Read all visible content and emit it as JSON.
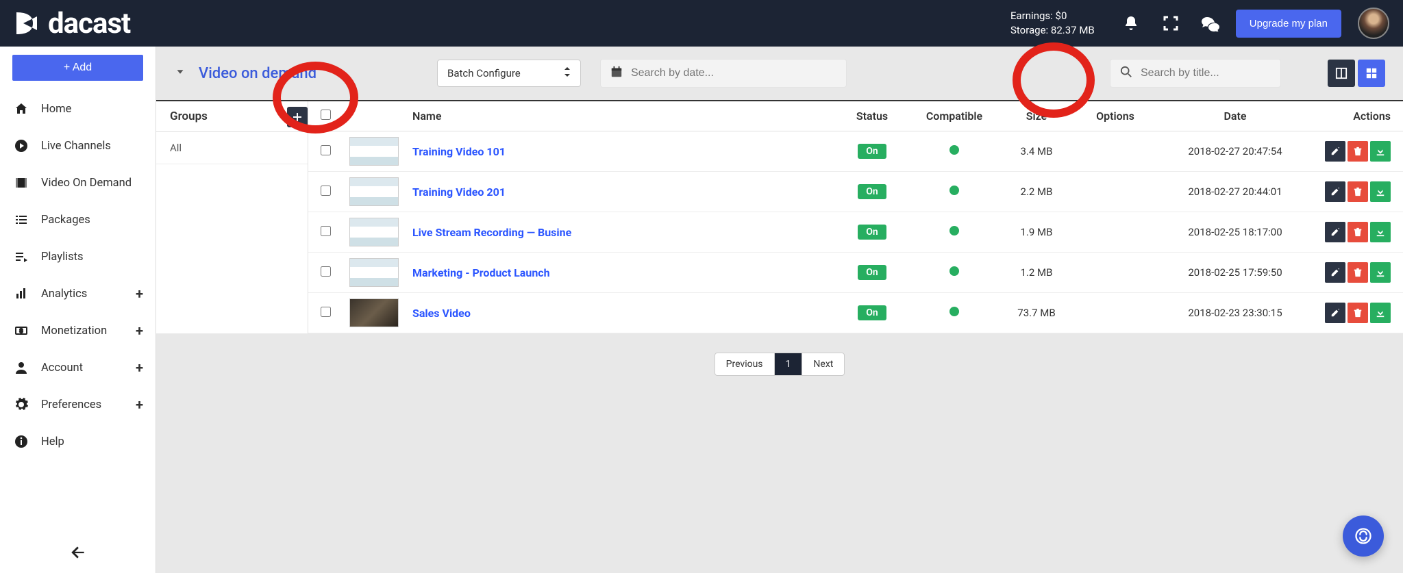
{
  "header": {
    "brand": "dacast",
    "earnings_label": "Earnings:",
    "earnings_value": "$0",
    "storage_label": "Storage:",
    "storage_value": "82.37 MB",
    "upgrade": "Upgrade my plan"
  },
  "sidebar": {
    "add_label": "+ Add",
    "items": [
      {
        "label": "Home"
      },
      {
        "label": "Live Channels"
      },
      {
        "label": "Video On Demand"
      },
      {
        "label": "Packages"
      },
      {
        "label": "Playlists"
      },
      {
        "label": "Analytics",
        "expandable": true
      },
      {
        "label": "Monetization",
        "expandable": true
      },
      {
        "label": "Account",
        "expandable": true
      },
      {
        "label": "Preferences",
        "expandable": true
      },
      {
        "label": "Help"
      }
    ]
  },
  "toolbar": {
    "title": "Video on demand",
    "batch_label": "Batch Configure",
    "search_date_placeholder": "Search by date...",
    "search_title_placeholder": "Search by title..."
  },
  "groups": {
    "header": "Groups",
    "items": [
      "All"
    ]
  },
  "table": {
    "columns": {
      "name": "Name",
      "status": "Status",
      "compatible": "Compatible",
      "size": "Size",
      "options": "Options",
      "date": "Date",
      "actions": "Actions"
    },
    "rows": [
      {
        "name": "Training Video 101",
        "status": "On",
        "size": "3.4 MB",
        "date": "2018-02-27 20:47:54",
        "thumb": "light"
      },
      {
        "name": "Training Video 201",
        "status": "On",
        "size": "2.2 MB",
        "date": "2018-02-27 20:44:01",
        "thumb": "light"
      },
      {
        "name": "Live Stream Recording — Busine",
        "status": "On",
        "size": "1.9 MB",
        "date": "2018-02-25 18:17:00",
        "thumb": "light"
      },
      {
        "name": "Marketing - Product Launch",
        "status": "On",
        "size": "1.2 MB",
        "date": "2018-02-25 17:59:50",
        "thumb": "light"
      },
      {
        "name": "Sales Video",
        "status": "On",
        "size": "73.7 MB",
        "date": "2018-02-23 23:30:15",
        "thumb": "dark"
      }
    ]
  },
  "pagination": {
    "prev": "Previous",
    "page": "1",
    "next": "Next"
  }
}
